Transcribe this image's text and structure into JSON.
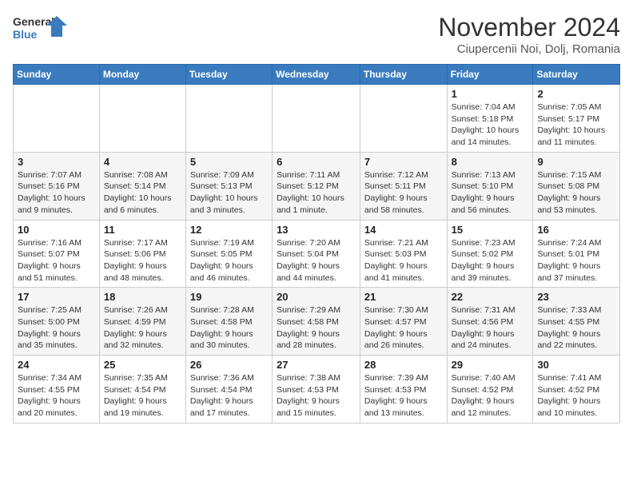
{
  "header": {
    "logo_line1": "General",
    "logo_line2": "Blue",
    "month": "November 2024",
    "location": "Ciupercenii Noi, Dolj, Romania"
  },
  "weekdays": [
    "Sunday",
    "Monday",
    "Tuesday",
    "Wednesday",
    "Thursday",
    "Friday",
    "Saturday"
  ],
  "weeks": [
    [
      {
        "day": "",
        "info": ""
      },
      {
        "day": "",
        "info": ""
      },
      {
        "day": "",
        "info": ""
      },
      {
        "day": "",
        "info": ""
      },
      {
        "day": "",
        "info": ""
      },
      {
        "day": "1",
        "info": "Sunrise: 7:04 AM\nSunset: 5:18 PM\nDaylight: 10 hours and 14 minutes."
      },
      {
        "day": "2",
        "info": "Sunrise: 7:05 AM\nSunset: 5:17 PM\nDaylight: 10 hours and 11 minutes."
      }
    ],
    [
      {
        "day": "3",
        "info": "Sunrise: 7:07 AM\nSunset: 5:16 PM\nDaylight: 10 hours and 9 minutes."
      },
      {
        "day": "4",
        "info": "Sunrise: 7:08 AM\nSunset: 5:14 PM\nDaylight: 10 hours and 6 minutes."
      },
      {
        "day": "5",
        "info": "Sunrise: 7:09 AM\nSunset: 5:13 PM\nDaylight: 10 hours and 3 minutes."
      },
      {
        "day": "6",
        "info": "Sunrise: 7:11 AM\nSunset: 5:12 PM\nDaylight: 10 hours and 1 minute."
      },
      {
        "day": "7",
        "info": "Sunrise: 7:12 AM\nSunset: 5:11 PM\nDaylight: 9 hours and 58 minutes."
      },
      {
        "day": "8",
        "info": "Sunrise: 7:13 AM\nSunset: 5:10 PM\nDaylight: 9 hours and 56 minutes."
      },
      {
        "day": "9",
        "info": "Sunrise: 7:15 AM\nSunset: 5:08 PM\nDaylight: 9 hours and 53 minutes."
      }
    ],
    [
      {
        "day": "10",
        "info": "Sunrise: 7:16 AM\nSunset: 5:07 PM\nDaylight: 9 hours and 51 minutes."
      },
      {
        "day": "11",
        "info": "Sunrise: 7:17 AM\nSunset: 5:06 PM\nDaylight: 9 hours and 48 minutes."
      },
      {
        "day": "12",
        "info": "Sunrise: 7:19 AM\nSunset: 5:05 PM\nDaylight: 9 hours and 46 minutes."
      },
      {
        "day": "13",
        "info": "Sunrise: 7:20 AM\nSunset: 5:04 PM\nDaylight: 9 hours and 44 minutes."
      },
      {
        "day": "14",
        "info": "Sunrise: 7:21 AM\nSunset: 5:03 PM\nDaylight: 9 hours and 41 minutes."
      },
      {
        "day": "15",
        "info": "Sunrise: 7:23 AM\nSunset: 5:02 PM\nDaylight: 9 hours and 39 minutes."
      },
      {
        "day": "16",
        "info": "Sunrise: 7:24 AM\nSunset: 5:01 PM\nDaylight: 9 hours and 37 minutes."
      }
    ],
    [
      {
        "day": "17",
        "info": "Sunrise: 7:25 AM\nSunset: 5:00 PM\nDaylight: 9 hours and 35 minutes."
      },
      {
        "day": "18",
        "info": "Sunrise: 7:26 AM\nSunset: 4:59 PM\nDaylight: 9 hours and 32 minutes."
      },
      {
        "day": "19",
        "info": "Sunrise: 7:28 AM\nSunset: 4:58 PM\nDaylight: 9 hours and 30 minutes."
      },
      {
        "day": "20",
        "info": "Sunrise: 7:29 AM\nSunset: 4:58 PM\nDaylight: 9 hours and 28 minutes."
      },
      {
        "day": "21",
        "info": "Sunrise: 7:30 AM\nSunset: 4:57 PM\nDaylight: 9 hours and 26 minutes."
      },
      {
        "day": "22",
        "info": "Sunrise: 7:31 AM\nSunset: 4:56 PM\nDaylight: 9 hours and 24 minutes."
      },
      {
        "day": "23",
        "info": "Sunrise: 7:33 AM\nSunset: 4:55 PM\nDaylight: 9 hours and 22 minutes."
      }
    ],
    [
      {
        "day": "24",
        "info": "Sunrise: 7:34 AM\nSunset: 4:55 PM\nDaylight: 9 hours and 20 minutes."
      },
      {
        "day": "25",
        "info": "Sunrise: 7:35 AM\nSunset: 4:54 PM\nDaylight: 9 hours and 19 minutes."
      },
      {
        "day": "26",
        "info": "Sunrise: 7:36 AM\nSunset: 4:54 PM\nDaylight: 9 hours and 17 minutes."
      },
      {
        "day": "27",
        "info": "Sunrise: 7:38 AM\nSunset: 4:53 PM\nDaylight: 9 hours and 15 minutes."
      },
      {
        "day": "28",
        "info": "Sunrise: 7:39 AM\nSunset: 4:53 PM\nDaylight: 9 hours and 13 minutes."
      },
      {
        "day": "29",
        "info": "Sunrise: 7:40 AM\nSunset: 4:52 PM\nDaylight: 9 hours and 12 minutes."
      },
      {
        "day": "30",
        "info": "Sunrise: 7:41 AM\nSunset: 4:52 PM\nDaylight: 9 hours and 10 minutes."
      }
    ]
  ]
}
